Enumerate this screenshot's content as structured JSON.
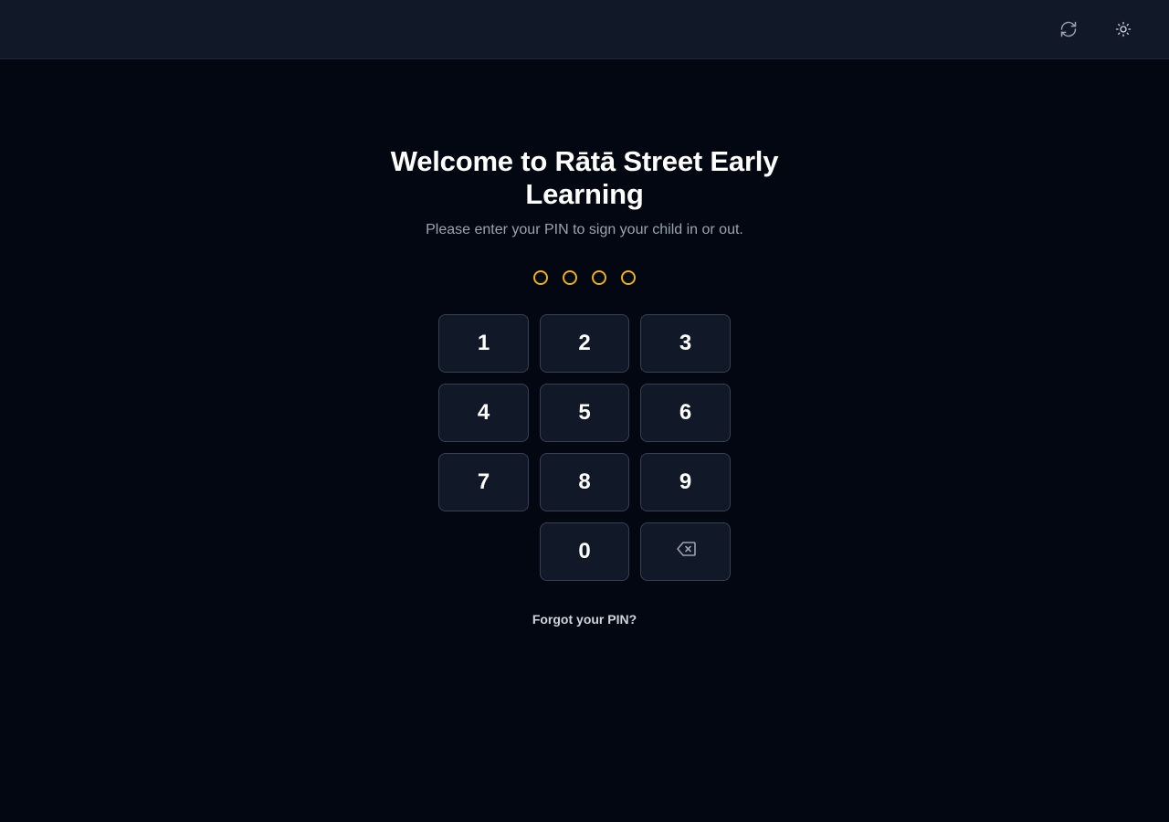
{
  "header": {
    "refresh_icon": "refresh-icon",
    "theme_icon": "sun-icon"
  },
  "main": {
    "title": "Welcome to Rātā Street Early Learning",
    "subtitle": "Please enter your PIN to sign your child in or out.",
    "pin_length": 4,
    "pin_entered": 0,
    "keys": [
      "1",
      "2",
      "3",
      "4",
      "5",
      "6",
      "7",
      "8",
      "9",
      "0"
    ],
    "backspace_icon": "backspace-icon",
    "forgot_link": "Forgot your PIN?"
  },
  "colors": {
    "background": "#030712",
    "topbar": "#111827",
    "key_bg": "#111827",
    "key_border": "#374151",
    "pin_dot": "#eab308",
    "subtitle": "#9ca3af",
    "link": "#d1d5db"
  }
}
